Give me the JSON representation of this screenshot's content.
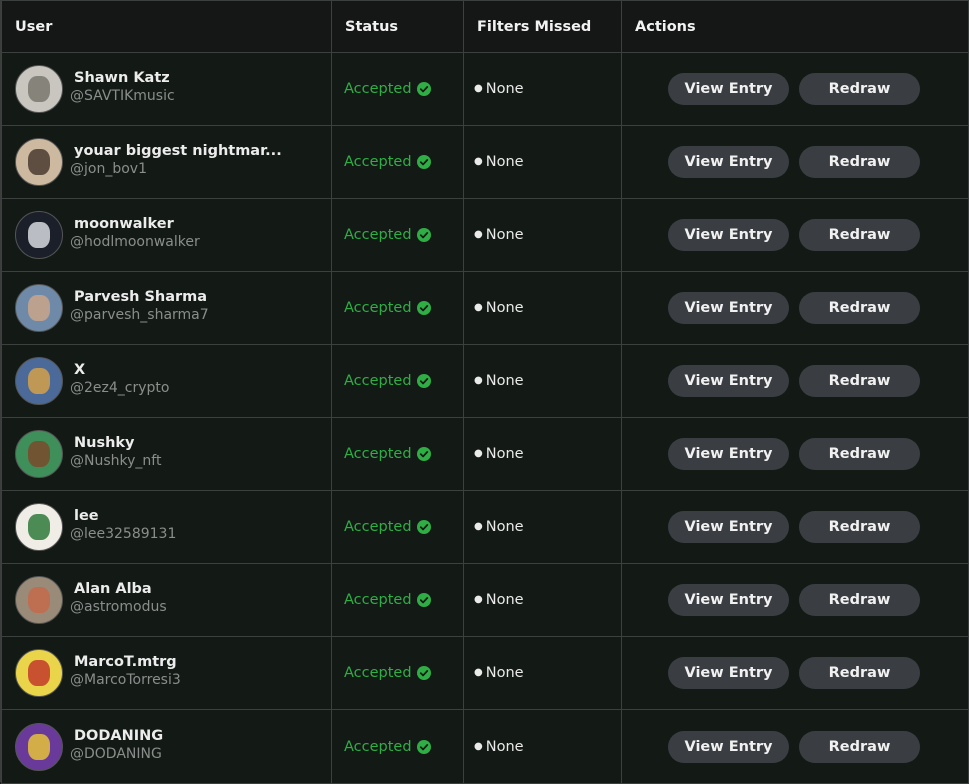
{
  "table": {
    "headers": {
      "user": "User",
      "status": "Status",
      "filters_missed": "Filters Missed",
      "actions": "Actions"
    },
    "rows": [
      {
        "name": "Shawn Katz",
        "handle": "@SAVTIKmusic",
        "status": "Accepted",
        "filters": "None",
        "view_label": "View Entry",
        "redraw_label": "Redraw",
        "avatar_bg": "#c9c6c0",
        "avatar_accent": "#7a776f"
      },
      {
        "name": "youar biggest nightmar...",
        "handle": "@jon_bov1",
        "status": "Accepted",
        "filters": "None",
        "view_label": "View Entry",
        "redraw_label": "Redraw",
        "avatar_bg": "#cdb8a0",
        "avatar_accent": "#4a3b30"
      },
      {
        "name": "moonwalker",
        "handle": "@hodlmoonwalker",
        "status": "Accepted",
        "filters": "None",
        "view_label": "View Entry",
        "redraw_label": "Redraw",
        "avatar_bg": "#1b1f2a",
        "avatar_accent": "#d7d9df"
      },
      {
        "name": "Parvesh Sharma",
        "handle": "@parvesh_sharma7",
        "status": "Accepted",
        "filters": "None",
        "view_label": "View Entry",
        "redraw_label": "Redraw",
        "avatar_bg": "#6f8aa8",
        "avatar_accent": "#c9a58a"
      },
      {
        "name": "X",
        "handle": "@2ez4_crypto",
        "status": "Accepted",
        "filters": "None",
        "view_label": "View Entry",
        "redraw_label": "Redraw",
        "avatar_bg": "#4b6a9a",
        "avatar_accent": "#d3a04a"
      },
      {
        "name": "Nushky",
        "handle": "@Nushky_nft",
        "status": "Accepted",
        "filters": "None",
        "view_label": "View Entry",
        "redraw_label": "Redraw",
        "avatar_bg": "#3e8f5a",
        "avatar_accent": "#7a4a2a"
      },
      {
        "name": "lee",
        "handle": "@lee32589131",
        "status": "Accepted",
        "filters": "None",
        "view_label": "View Entry",
        "redraw_label": "Redraw",
        "avatar_bg": "#f0ece6",
        "avatar_accent": "#2f7a3a"
      },
      {
        "name": "Alan Alba",
        "handle": "@astromodus",
        "status": "Accepted",
        "filters": "None",
        "view_label": "View Entry",
        "redraw_label": "Redraw",
        "avatar_bg": "#9a8a78",
        "avatar_accent": "#c46a4a"
      },
      {
        "name": "MarcoT.mtrg",
        "handle": "@MarcoTorresi3",
        "status": "Accepted",
        "filters": "None",
        "view_label": "View Entry",
        "redraw_label": "Redraw",
        "avatar_bg": "#e9d44a",
        "avatar_accent": "#c23a2a"
      },
      {
        "name": "DODANING",
        "handle": "@DODANING",
        "status": "Accepted",
        "filters": "None",
        "view_label": "View Entry",
        "redraw_label": "Redraw",
        "avatar_bg": "#6a3a9a",
        "avatar_accent": "#e5c23a"
      }
    ]
  },
  "colors": {
    "accepted": "#2fae45",
    "row_bg": "#131a15",
    "header_bg": "#151716",
    "button_bg": "#3a3e43"
  },
  "icons": {
    "status": "check-circle-icon",
    "bullet": "bullet-icon"
  }
}
